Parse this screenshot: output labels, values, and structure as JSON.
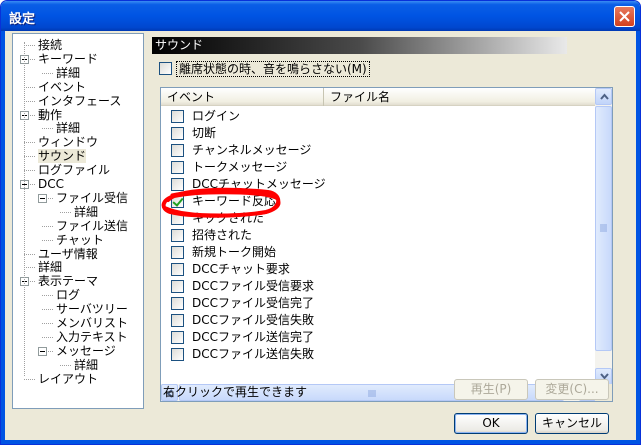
{
  "window": {
    "title": "設定"
  },
  "tree": {
    "items": [
      {
        "label": "接続",
        "level": 0
      },
      {
        "label": "キーワード",
        "level": 0,
        "expanded": true
      },
      {
        "label": "詳細",
        "level": 1
      },
      {
        "label": "イベント",
        "level": 0
      },
      {
        "label": "インタフェース",
        "level": 0
      },
      {
        "label": "動作",
        "level": 0,
        "expanded": true
      },
      {
        "label": "詳細",
        "level": 1
      },
      {
        "label": "ウィンドウ",
        "level": 0
      },
      {
        "label": "サウンド",
        "level": 0,
        "selected": true
      },
      {
        "label": "ログファイル",
        "level": 0
      },
      {
        "label": "DCC",
        "level": 0,
        "expanded": true
      },
      {
        "label": "ファイル受信",
        "level": 1,
        "expanded": true
      },
      {
        "label": "詳細",
        "level": 2
      },
      {
        "label": "ファイル送信",
        "level": 1
      },
      {
        "label": "チャット",
        "level": 1
      },
      {
        "label": "ユーザ情報",
        "level": 0
      },
      {
        "label": "詳細",
        "level": 0
      },
      {
        "label": "表示テーマ",
        "level": 0,
        "expanded": true
      },
      {
        "label": "ログ",
        "level": 1
      },
      {
        "label": "サーバツリー",
        "level": 1
      },
      {
        "label": "メンバリスト",
        "level": 1
      },
      {
        "label": "入力テキスト",
        "level": 1
      },
      {
        "label": "メッセージ",
        "level": 1,
        "expanded": true
      },
      {
        "label": "詳細",
        "level": 2
      },
      {
        "label": "レイアウト",
        "level": 0
      }
    ]
  },
  "section": {
    "title": "サウンド"
  },
  "away_checkbox": {
    "label": "離席状態の時、音を鳴らさない(M)",
    "checked": false
  },
  "listview": {
    "columns": [
      "イベント",
      "ファイル名"
    ],
    "rows": [
      {
        "label": "ログイン",
        "checked": false
      },
      {
        "label": "切断",
        "checked": false
      },
      {
        "label": "チャンネルメッセージ",
        "checked": false
      },
      {
        "label": "トークメッセージ",
        "checked": false
      },
      {
        "label": "DCCチャットメッセージ",
        "checked": false
      },
      {
        "label": "キーワード反応",
        "checked": true
      },
      {
        "label": "キックされた",
        "checked": false
      },
      {
        "label": "招待された",
        "checked": false
      },
      {
        "label": "新規トーク開始",
        "checked": false
      },
      {
        "label": "DCCチャット要求",
        "checked": false
      },
      {
        "label": "DCCファイル受信要求",
        "checked": false
      },
      {
        "label": "DCCファイル受信完了",
        "checked": false
      },
      {
        "label": "DCCファイル受信失敗",
        "checked": false
      },
      {
        "label": "DCCファイル送信完了",
        "checked": false
      },
      {
        "label": "DCCファイル送信失敗",
        "checked": false
      }
    ]
  },
  "hint": "右クリックで再生できます",
  "buttons": {
    "play": "再生(P)",
    "change": "変更(C)...",
    "ok": "OK",
    "cancel": "キャンセル"
  },
  "colors": {
    "titlebar": "#0054e3",
    "highlight_scribble": "#ff0000",
    "check_mark": "#21a121"
  }
}
